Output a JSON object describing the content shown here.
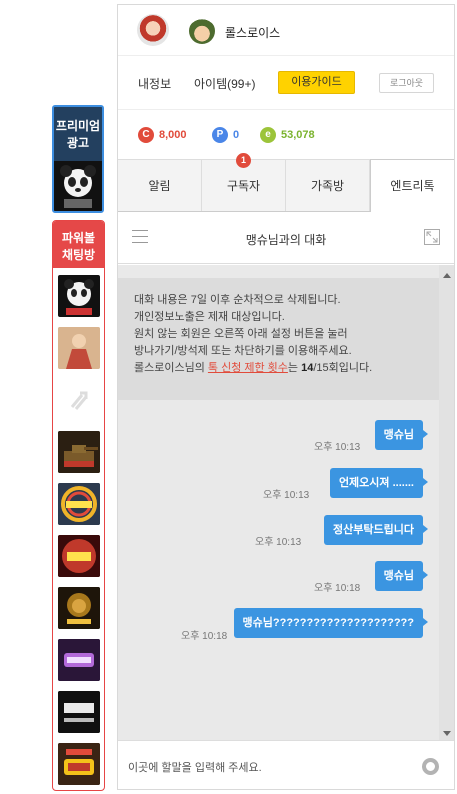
{
  "sidebar": {
    "premium_label": "프리미엄\n광고",
    "power_label": "파워볼\n채팅방",
    "thumbnails": [
      {
        "name": "panda-thumb",
        "color": "#111111"
      },
      {
        "name": "girl-thumb",
        "color": "#c24a3a"
      },
      {
        "name": "placeholder-thumb",
        "color": "#ffffff"
      },
      {
        "name": "tank-thumb",
        "color": "#3a2a18"
      },
      {
        "name": "rainbow-logo-thumb",
        "color": "#34445a"
      },
      {
        "name": "red-logo-thumb",
        "color": "#5a1010"
      },
      {
        "name": "lion-thumb",
        "color": "#2a1d0c"
      },
      {
        "name": "purple-logo-thumb",
        "color": "#3a1d4a"
      },
      {
        "name": "zinbbaei-thumb",
        "color": "#151515"
      },
      {
        "name": "yellow-logo-thumb",
        "color": "#2c1a10"
      }
    ]
  },
  "profile": {
    "nickname": "롤스로이스"
  },
  "menu": {
    "my_info": "내정보",
    "items": "아이템(99+)",
    "guide": "이용가이드",
    "logout": "로그아웃"
  },
  "points": [
    {
      "icon": "C",
      "value": "8,000",
      "color": "#e14b3b"
    },
    {
      "icon": "P",
      "value": "0",
      "color": "#4a86e8"
    },
    {
      "icon": "e",
      "value": "53,078",
      "color": "#7bb32e"
    }
  ],
  "tabs": [
    {
      "label": "알림"
    },
    {
      "label": "구독자",
      "badge": "1"
    },
    {
      "label": "가족방"
    },
    {
      "label": "엔트리톡"
    }
  ],
  "chat": {
    "title": "맹슈님과의 대화",
    "notice_lines": [
      "대화 내용은 7일 이후 순차적으로 삭제됩니다.",
      "개인정보노출은 제재 대상입니다.",
      "원치 않는 회원은 오른쪽 아래 설정 버튼을 눌러",
      "방나가기/방석제 또는 차단하기를 이용해주세요."
    ],
    "notice_last_prefix": "롤스로이스님의 ",
    "notice_last_link": "톡 신청 제한 횟수",
    "notice_last_mid": "는 ",
    "notice_last_count": "14",
    "notice_last_suffix": "/15회입니다.",
    "messages": [
      {
        "text": "맹슈님",
        "time": "오후 10:13"
      },
      {
        "text": "언제오시져 .......",
        "time": "오후 10:13"
      },
      {
        "text": "정산부탁드립니다",
        "time": "오후 10:13"
      },
      {
        "text": "맹슈님",
        "time": "오후 10:18"
      },
      {
        "text": "맹슈님?????????????????????",
        "time": "오후 10:18"
      }
    ],
    "input_placeholder": "이곳에 할말을 입력해 주세요."
  }
}
